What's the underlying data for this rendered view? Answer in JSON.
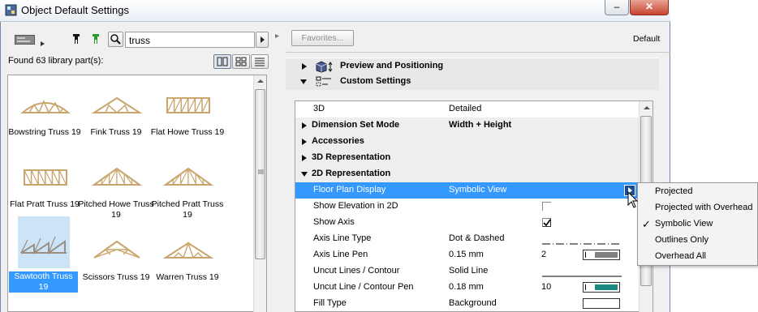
{
  "window": {
    "title": "Object Default Settings",
    "minimize_glyph": "–",
    "maximize_glyph": "☐",
    "close_glyph": "✕"
  },
  "library": {
    "search_value": "truss",
    "found_text": "Found 63 library part(s):",
    "parts": [
      {
        "label": "Bowstring Truss 19",
        "icon": "bowstring-truss-thumb"
      },
      {
        "label": "Fink Truss 19",
        "icon": "fink-truss-thumb"
      },
      {
        "label": "Flat Howe Truss 19",
        "icon": "flat-howe-truss-thumb"
      },
      {
        "label": "Flat Pratt Truss 19",
        "icon": "flat-pratt-truss-thumb"
      },
      {
        "label": "Pitched Howe Truss 19",
        "icon": "pitched-howe-truss-thumb"
      },
      {
        "label": "Pitched Pratt Truss 19",
        "icon": "pitched-pratt-truss-thumb"
      },
      {
        "label": "Sawtooth Truss 19",
        "icon": "sawtooth-truss-thumb",
        "selected": true
      },
      {
        "label": "Scissors Truss 19",
        "icon": "scissors-truss-thumb"
      },
      {
        "label": "Warren Truss 19",
        "icon": "warren-truss-thumb"
      }
    ],
    "selection_color": "#cce4f7",
    "selected_label_bg": "#3399ff"
  },
  "settings": {
    "favorites_label": "Favorites...",
    "default_label": "Default",
    "panels": [
      {
        "label": "Preview and Positioning",
        "expanded": false
      },
      {
        "label": "Custom Settings",
        "expanded": true
      }
    ]
  },
  "params": {
    "rows": [
      {
        "label": "3D",
        "value": "Detailed",
        "kind": "plain"
      },
      {
        "label": "Dimension Set Mode",
        "value": "Width + Height",
        "kind": "group-collapsed"
      },
      {
        "label": "Accessories",
        "value": "",
        "kind": "group-collapsed"
      },
      {
        "label": "3D Representation",
        "value": "",
        "kind": "group-collapsed"
      },
      {
        "label": "2D Representation",
        "value": "",
        "kind": "group-expanded"
      },
      {
        "label": "Floor Plan Display",
        "value": "Symbolic View",
        "kind": "selected"
      },
      {
        "label": "Show Elevation in 2D",
        "value": "",
        "kind": "checkbox",
        "checked": false
      },
      {
        "label": "Show Axis",
        "value": "",
        "kind": "checkbox",
        "checked": true
      },
      {
        "label": "Axis Line Type",
        "value": "Dot & Dashed",
        "kind": "linetype"
      },
      {
        "label": "Axis Line Pen",
        "value": "0.15 mm",
        "kind": "pen",
        "pen": "2",
        "pen_color": "#7f7f7f"
      },
      {
        "label": "Uncut Lines / Contour",
        "value": "Solid Line",
        "kind": "solidline"
      },
      {
        "label": "Uncut Line / Contour Pen",
        "value": "0.18 mm",
        "kind": "pen",
        "pen": "10",
        "pen_color": "#1a8a80"
      },
      {
        "label": "Fill Type",
        "value": "Background",
        "kind": "fill"
      }
    ],
    "selected_color": "#3399ff"
  },
  "dropdown": {
    "options": [
      "Projected",
      "Projected with Overhead",
      "Symbolic View",
      "Outlines Only",
      "Overhead All"
    ],
    "checked_index": 2,
    "check_glyph": "✓"
  }
}
